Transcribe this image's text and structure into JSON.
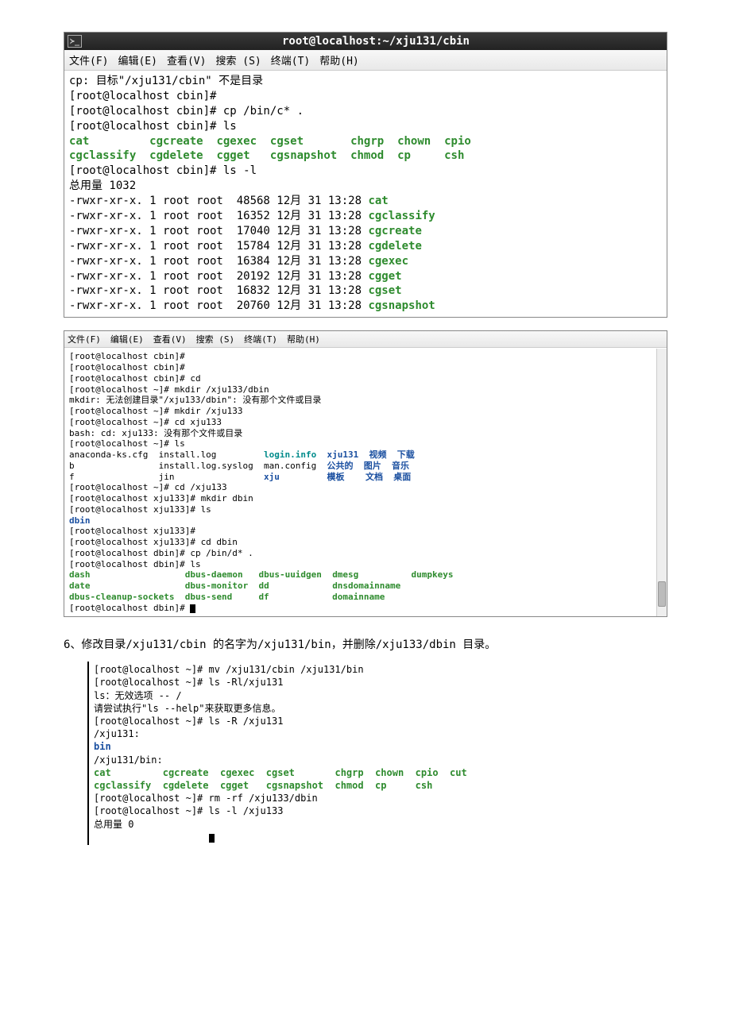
{
  "term1": {
    "title": "root@localhost:~/xju131/cbin",
    "menus": [
      "文件(F)",
      "编辑(E)",
      "查看(V)",
      "搜索 (S)",
      "终端(T)",
      "帮助(H)"
    ],
    "lines": [
      {
        "segs": [
          {
            "t": "cp: 目标\"/xju131/cbin\" 不是目录"
          }
        ]
      },
      {
        "segs": [
          {
            "t": "[root@localhost cbin]#"
          }
        ]
      },
      {
        "segs": [
          {
            "t": "[root@localhost cbin]# cp /bin/c* ."
          }
        ]
      },
      {
        "segs": [
          {
            "t": "[root@localhost cbin]# ls"
          }
        ]
      },
      {
        "segs": [
          {
            "t": "cat",
            "c": "green"
          },
          {
            "t": "         "
          },
          {
            "t": "cgcreate",
            "c": "green"
          },
          {
            "t": "  "
          },
          {
            "t": "cgexec",
            "c": "green"
          },
          {
            "t": "  "
          },
          {
            "t": "cgset",
            "c": "green"
          },
          {
            "t": "       "
          },
          {
            "t": "chgrp",
            "c": "green"
          },
          {
            "t": "  "
          },
          {
            "t": "chown",
            "c": "green"
          },
          {
            "t": "  "
          },
          {
            "t": "cpio",
            "c": "green"
          }
        ]
      },
      {
        "segs": [
          {
            "t": "cgclassify",
            "c": "green"
          },
          {
            "t": "  "
          },
          {
            "t": "cgdelete",
            "c": "green"
          },
          {
            "t": "  "
          },
          {
            "t": "cgget",
            "c": "green"
          },
          {
            "t": "   "
          },
          {
            "t": "cgsnapshot",
            "c": "green"
          },
          {
            "t": "  "
          },
          {
            "t": "chmod",
            "c": "green"
          },
          {
            "t": "  "
          },
          {
            "t": "cp",
            "c": "green"
          },
          {
            "t": "     "
          },
          {
            "t": "csh",
            "c": "green"
          }
        ]
      },
      {
        "segs": [
          {
            "t": "[root@localhost cbin]# ls -l"
          }
        ]
      },
      {
        "segs": [
          {
            "t": "总用量 1032"
          }
        ]
      },
      {
        "segs": [
          {
            "t": "-rwxr-xr-x. 1 root root  48568 12月 31 13:28 "
          },
          {
            "t": "cat",
            "c": "green"
          }
        ]
      },
      {
        "segs": [
          {
            "t": "-rwxr-xr-x. 1 root root  16352 12月 31 13:28 "
          },
          {
            "t": "cgclassify",
            "c": "green"
          }
        ]
      },
      {
        "segs": [
          {
            "t": "-rwxr-xr-x. 1 root root  17040 12月 31 13:28 "
          },
          {
            "t": "cgcreate",
            "c": "green"
          }
        ]
      },
      {
        "segs": [
          {
            "t": "-rwxr-xr-x. 1 root root  15784 12月 31 13:28 "
          },
          {
            "t": "cgdelete",
            "c": "green"
          }
        ]
      },
      {
        "segs": [
          {
            "t": "-rwxr-xr-x. 1 root root  16384 12月 31 13:28 "
          },
          {
            "t": "cgexec",
            "c": "green"
          }
        ]
      },
      {
        "segs": [
          {
            "t": "-rwxr-xr-x. 1 root root  20192 12月 31 13:28 "
          },
          {
            "t": "cgget",
            "c": "green"
          }
        ]
      },
      {
        "segs": [
          {
            "t": "-rwxr-xr-x. 1 root root  16832 12月 31 13:28 "
          },
          {
            "t": "cgset",
            "c": "green"
          }
        ]
      },
      {
        "segs": [
          {
            "t": "-rwxr-xr-x. 1 root root  20760 12月 31 13:28 "
          },
          {
            "t": "cgsnapshot",
            "c": "green"
          }
        ]
      }
    ]
  },
  "term2": {
    "menus": [
      "文件(F)",
      "编辑(E)",
      "查看(V)",
      "搜索 (S)",
      "终端(T)",
      "帮助(H)"
    ],
    "lines": [
      {
        "segs": [
          {
            "t": "[root@localhost cbin]#"
          }
        ]
      },
      {
        "segs": [
          {
            "t": "[root@localhost cbin]#"
          }
        ]
      },
      {
        "segs": [
          {
            "t": "[root@localhost cbin]# cd"
          }
        ]
      },
      {
        "segs": [
          {
            "t": "[root@localhost ~]# mkdir /xju133/dbin"
          }
        ]
      },
      {
        "segs": [
          {
            "t": "mkdir: 无法创建目录\"/xju133/dbin\": 没有那个文件或目录"
          }
        ]
      },
      {
        "segs": [
          {
            "t": "[root@localhost ~]# mkdir /xju133"
          }
        ]
      },
      {
        "segs": [
          {
            "t": "[root@localhost ~]# cd xju133"
          }
        ]
      },
      {
        "segs": [
          {
            "t": "bash: cd: xju133: 没有那个文件或目录"
          }
        ]
      },
      {
        "segs": [
          {
            "t": "[root@localhost ~]# ls"
          }
        ]
      },
      {
        "segs": [
          {
            "t": "anaconda-ks.cfg  install.log         "
          },
          {
            "t": "login.info",
            "c": "teal"
          },
          {
            "t": "  "
          },
          {
            "t": "xju131",
            "c": "blue"
          },
          {
            "t": "  "
          },
          {
            "t": "视频",
            "c": "blue"
          },
          {
            "t": "  "
          },
          {
            "t": "下载",
            "c": "blue"
          }
        ]
      },
      {
        "segs": [
          {
            "t": "b                install.log.syslog  man.config  "
          },
          {
            "t": "公共的",
            "c": "blue"
          },
          {
            "t": "  "
          },
          {
            "t": "图片",
            "c": "blue"
          },
          {
            "t": "  "
          },
          {
            "t": "音乐",
            "c": "blue"
          }
        ]
      },
      {
        "segs": [
          {
            "t": "f                jin                 "
          },
          {
            "t": "xju",
            "c": "blue"
          },
          {
            "t": "         "
          },
          {
            "t": "模板",
            "c": "blue"
          },
          {
            "t": "    "
          },
          {
            "t": "文档",
            "c": "blue"
          },
          {
            "t": "  "
          },
          {
            "t": "桌面",
            "c": "blue"
          }
        ]
      },
      {
        "segs": [
          {
            "t": "[root@localhost ~]# cd /xju133"
          }
        ]
      },
      {
        "segs": [
          {
            "t": "[root@localhost xju133]# mkdir dbin"
          }
        ]
      },
      {
        "segs": [
          {
            "t": "[root@localhost xju133]# ls"
          }
        ]
      },
      {
        "segs": [
          {
            "t": "dbin",
            "c": "blue"
          }
        ]
      },
      {
        "segs": [
          {
            "t": "[root@localhost xju133]#"
          }
        ]
      },
      {
        "segs": [
          {
            "t": "[root@localhost xju133]# cd dbin"
          }
        ]
      },
      {
        "segs": [
          {
            "t": "[root@localhost dbin]# cp /bin/d* ."
          }
        ]
      },
      {
        "segs": [
          {
            "t": "[root@localhost dbin]# ls"
          }
        ]
      },
      {
        "segs": [
          {
            "t": "dash",
            "c": "green"
          },
          {
            "t": "                  "
          },
          {
            "t": "dbus-daemon",
            "c": "green"
          },
          {
            "t": "   "
          },
          {
            "t": "dbus-uuidgen",
            "c": "green"
          },
          {
            "t": "  "
          },
          {
            "t": "dmesg",
            "c": "green"
          },
          {
            "t": "          "
          },
          {
            "t": "dumpkeys",
            "c": "green"
          }
        ]
      },
      {
        "segs": [
          {
            "t": "date",
            "c": "green"
          },
          {
            "t": "                  "
          },
          {
            "t": "dbus-monitor",
            "c": "green"
          },
          {
            "t": "  "
          },
          {
            "t": "dd",
            "c": "green"
          },
          {
            "t": "            "
          },
          {
            "t": "dnsdomainname",
            "c": "green"
          }
        ]
      },
      {
        "segs": [
          {
            "t": "dbus-cleanup-sockets",
            "c": "green"
          },
          {
            "t": "  "
          },
          {
            "t": "dbus-send",
            "c": "green"
          },
          {
            "t": "     "
          },
          {
            "t": "df",
            "c": "green"
          },
          {
            "t": "            "
          },
          {
            "t": "domainname",
            "c": "green"
          }
        ]
      },
      {
        "segs": [
          {
            "t": "[root@localhost dbin]# "
          },
          {
            "cursor": true
          }
        ]
      }
    ]
  },
  "question": "6、修改目录/xju131/cbin 的名字为/xju131/bin，并删除/xju133/dbin 目录。",
  "snippet": {
    "lines": [
      {
        "segs": [
          {
            "t": "[root@localhost ~]# mv /xju131/cbin /xju131/bin"
          }
        ]
      },
      {
        "segs": [
          {
            "t": "[root@localhost ~]# ls -Rl/xju131"
          }
        ]
      },
      {
        "segs": [
          {
            "t": "ls：无效选项 -- /"
          }
        ]
      },
      {
        "segs": [
          {
            "t": "请尝试执行\"ls --help\"来获取更多信息。"
          }
        ]
      },
      {
        "segs": [
          {
            "t": "[root@localhost ~]# ls -R /xju131"
          }
        ]
      },
      {
        "segs": [
          {
            "t": "/xju131:"
          }
        ]
      },
      {
        "segs": [
          {
            "t": "bin",
            "c": "blue"
          }
        ]
      },
      {
        "segs": [
          {
            "t": ""
          }
        ]
      },
      {
        "segs": [
          {
            "t": "/xju131/bin:"
          }
        ]
      },
      {
        "segs": [
          {
            "t": "cat",
            "c": "green"
          },
          {
            "t": "         "
          },
          {
            "t": "cgcreate",
            "c": "green"
          },
          {
            "t": "  "
          },
          {
            "t": "cgexec",
            "c": "green"
          },
          {
            "t": "  "
          },
          {
            "t": "cgset",
            "c": "green"
          },
          {
            "t": "       "
          },
          {
            "t": "chgrp",
            "c": "green"
          },
          {
            "t": "  "
          },
          {
            "t": "chown",
            "c": "green"
          },
          {
            "t": "  "
          },
          {
            "t": "cpio",
            "c": "green"
          },
          {
            "t": "  "
          },
          {
            "t": "cut",
            "c": "green"
          }
        ]
      },
      {
        "segs": [
          {
            "t": "cgclassify",
            "c": "green"
          },
          {
            "t": "  "
          },
          {
            "t": "cgdelete",
            "c": "green"
          },
          {
            "t": "  "
          },
          {
            "t": "cgget",
            "c": "green"
          },
          {
            "t": "   "
          },
          {
            "t": "cgsnapshot",
            "c": "green"
          },
          {
            "t": "  "
          },
          {
            "t": "chmod",
            "c": "green"
          },
          {
            "t": "  "
          },
          {
            "t": "cp",
            "c": "green"
          },
          {
            "t": "     "
          },
          {
            "t": "csh",
            "c": "green"
          }
        ]
      },
      {
        "segs": [
          {
            "t": "[root@localhost ~]# rm -rf /xju133/dbin"
          }
        ]
      },
      {
        "segs": [
          {
            "t": "[root@localhost ~]# ls -l /xju133"
          }
        ]
      },
      {
        "segs": [
          {
            "t": "总用量 0"
          }
        ]
      },
      {
        "segs": [
          {
            "t": "                    "
          },
          {
            "cursor": true
          }
        ]
      }
    ]
  }
}
